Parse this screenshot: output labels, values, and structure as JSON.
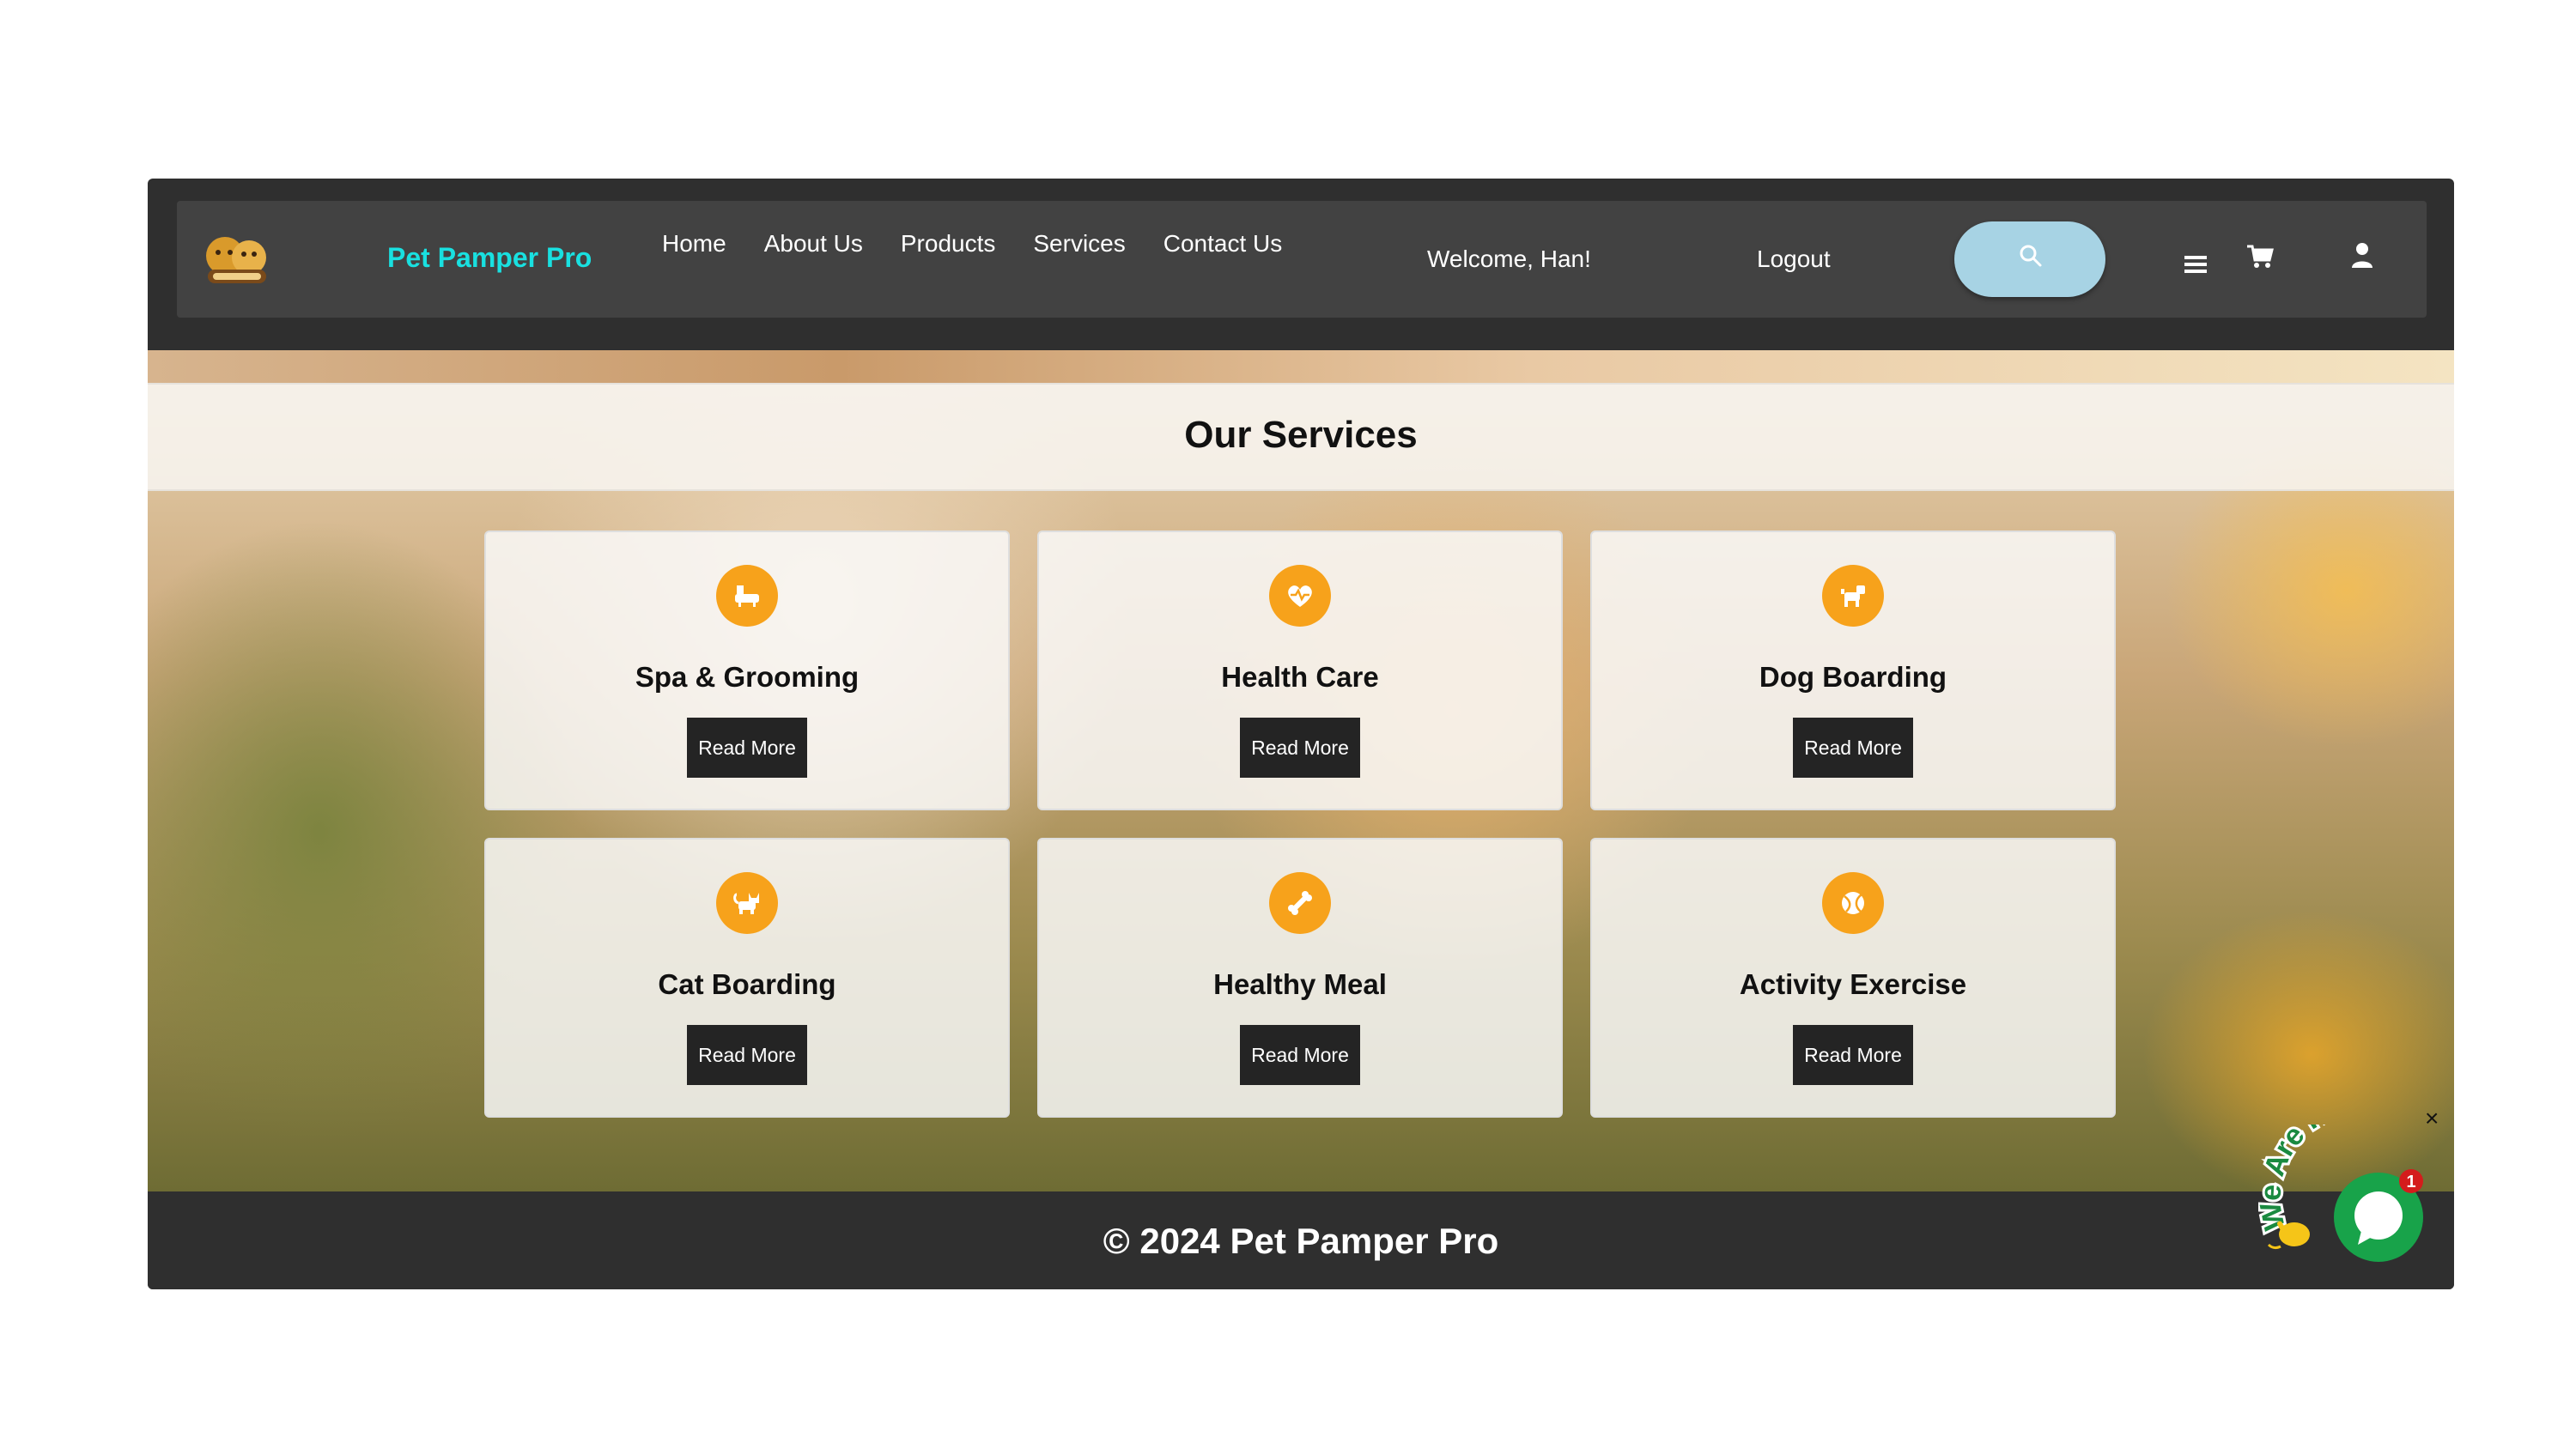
{
  "header": {
    "brand": "Pet Pamper Pro",
    "logo_icon": "pet-shop-logo",
    "nav": [
      "Home",
      "About Us",
      "Products",
      "Services",
      "Contact Us"
    ],
    "welcome": "Welcome, Han!",
    "logout": "Logout",
    "icons": {
      "search": "search-icon",
      "menu": "hamburger-menu-icon",
      "cart": "cart-icon",
      "user": "user-icon"
    },
    "colors": {
      "brand": "#19e0e0",
      "navbar": "#424242",
      "search_pill": "#a7d3e4"
    }
  },
  "services": {
    "title": "Our Services",
    "items": [
      {
        "title": "Spa & Grooming",
        "button": "Read More",
        "icon": "bathtub-icon"
      },
      {
        "title": "Health Care",
        "button": "Read More",
        "icon": "heart-pulse-icon"
      },
      {
        "title": "Dog Boarding",
        "button": "Read More",
        "icon": "dog-icon"
      },
      {
        "title": "Cat Boarding",
        "button": "Read More",
        "icon": "cat-icon"
      },
      {
        "title": "Healthy Meal",
        "button": "Read More",
        "icon": "bone-icon"
      },
      {
        "title": "Activity Exercise",
        "button": "Read More",
        "icon": "ball-icon"
      }
    ],
    "colors": {
      "icon_circle": "#f7a21b",
      "button": "#242424"
    }
  },
  "footer": {
    "text": "© 2024 Pet Pamper Pro"
  },
  "chat": {
    "label": "We Are Here!",
    "badge": "1",
    "close": "×",
    "colors": {
      "bubble": "#18a34a",
      "badge": "#d41c1c"
    }
  }
}
